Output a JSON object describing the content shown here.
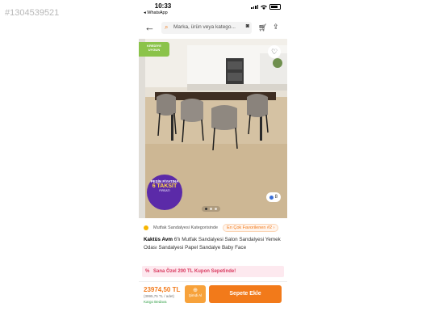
{
  "watermark": "#1304539521",
  "status": {
    "time": "10:33",
    "back_app": "◂ WhatsApp"
  },
  "search": {
    "placeholder": "Marka, ürün veya katego..."
  },
  "image": {
    "corner_badge": "KREDİYE UYGUN",
    "promo": {
      "line1": "PEŞİN FİYATINA",
      "line2": "6 TAKSİT",
      "line3": "FIRSATI"
    },
    "photo_count": "8"
  },
  "category": {
    "text": "Mutfak Sandalyesi Kategorisinde",
    "favorite_chip": "En Çok Favorilenen #2 ›"
  },
  "product": {
    "brand": "Kaktüs Avm",
    "title": "6'lı Mutfak Sandalyesi Salon Sandalyesi Yemek Odası Sandalyesi Papel Sandalye Baby Face"
  },
  "coupon": {
    "icon": "%",
    "text": "Sana Özel 200 TL Kupon Sepetinde!"
  },
  "price": {
    "main": "23974,50 TL",
    "sub": "(3995,75 TL / adet)",
    "cargo": "Kargo Bedava"
  },
  "buttons": {
    "buy_now": "Şimdi Al",
    "add_to_cart": "Sepete Ekle"
  },
  "colors": {
    "accent": "#f27a1a",
    "buy_now": "#f7a23b",
    "coupon": "#d93b60"
  }
}
